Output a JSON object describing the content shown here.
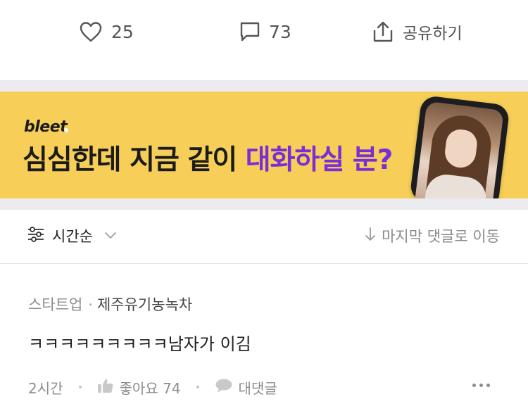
{
  "actions": {
    "like_count": "25",
    "comment_count": "73",
    "share_label": "공유하기"
  },
  "banner": {
    "brand": "bleet",
    "headline_main": "심심한데 지금 같이 ",
    "headline_accent": "대화하실 분?",
    "accent_color": "#7a2fd6",
    "background_color": "#f7cf58"
  },
  "sort": {
    "label": "시간순",
    "jump_label": "마지막 댓글로 이동"
  },
  "comment": {
    "category": "스타트업",
    "author": "제주유기농녹차",
    "text": "ㅋㅋㅋㅋㅋㅋㅋㅋㅋ남자가 이김",
    "time": "2시간",
    "like_label": "좋아요 74",
    "reply_label": "대댓글"
  },
  "icons": [
    "heart-icon",
    "comment-bubble-icon",
    "share-icon",
    "sort-filter-icon",
    "chevron-down-icon",
    "arrow-down-icon",
    "thumb-up-icon",
    "speech-bubble-icon",
    "more-icon"
  ]
}
